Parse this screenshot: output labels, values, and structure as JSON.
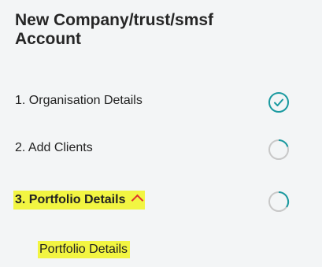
{
  "panel": {
    "title": "New Company/trust/smsf Account"
  },
  "steps": [
    {
      "label": "1. Organisation Details",
      "status": "complete"
    },
    {
      "label": "2. Add Clients",
      "status": "in-progress"
    },
    {
      "label": "3. Portfolio Details",
      "status": "in-progress",
      "expanded": true
    }
  ],
  "sub_items": [
    {
      "label": "Portfolio Details"
    }
  ],
  "colors": {
    "accent": "#1a9aa0",
    "pending": "#c8c8c8",
    "highlight": "#f2f542",
    "chevron": "#e0342c"
  },
  "icons": {
    "complete": "check-circle-icon",
    "in_progress": "progress-circle-icon",
    "expand": "chevron-up-icon"
  }
}
